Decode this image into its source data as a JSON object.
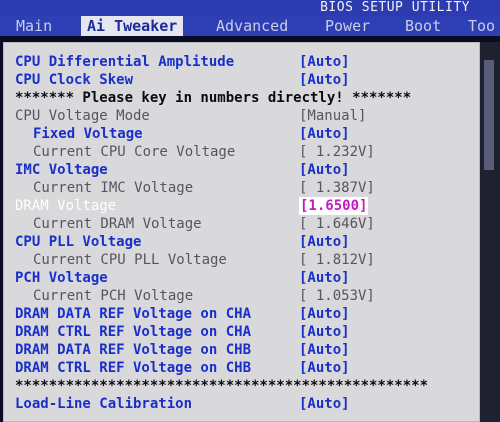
{
  "window": {
    "title": "BIOS SETUP UTILITY"
  },
  "tabs": [
    {
      "label": "Main"
    },
    {
      "label": "Ai Tweaker"
    },
    {
      "label": "Advanced"
    },
    {
      "label": "Power"
    },
    {
      "label": "Boot"
    },
    {
      "label": "Too"
    }
  ],
  "active_tab": "Ai Tweaker",
  "settings": {
    "cpu_diff_amp": {
      "label": "CPU Differential Amplitude",
      "value": "[Auto]"
    },
    "cpu_clock_skew": {
      "label": "CPU Clock Skew",
      "value": "[Auto]"
    },
    "notice": "******* Please key in numbers directly! *******",
    "cpu_voltage_mode": {
      "label": "CPU Voltage Mode",
      "value": "[Manual]"
    },
    "fixed_voltage": {
      "label": "Fixed Voltage",
      "value": "[Auto]"
    },
    "current_cpu_core_voltage": {
      "label": "Current CPU Core Voltage",
      "value": "[ 1.232V]"
    },
    "imc_voltage": {
      "label": "IMC Voltage",
      "value": "[Auto]"
    },
    "current_imc_voltage": {
      "label": "Current IMC Voltage",
      "value": "[ 1.387V]"
    },
    "dram_voltage": {
      "label": "DRAM Voltage",
      "value": "[1.6500]"
    },
    "current_dram_voltage": {
      "label": "Current DRAM Voltage",
      "value": "[ 1.646V]"
    },
    "cpu_pll_voltage": {
      "label": "CPU PLL Voltage",
      "value": "[Auto]"
    },
    "current_cpu_pll_voltage": {
      "label": "Current CPU PLL Voltage",
      "value": "[ 1.812V]"
    },
    "pch_voltage": {
      "label": "PCH Voltage",
      "value": "[Auto]"
    },
    "current_pch_voltage": {
      "label": "Current PCH Voltage",
      "value": "[ 1.053V]"
    },
    "dram_data_ref_cha": {
      "label": "DRAM DATA REF Voltage on CHA",
      "value": "[Auto]"
    },
    "dram_ctrl_ref_cha": {
      "label": "DRAM CTRL REF Voltage on CHA",
      "value": "[Auto]"
    },
    "dram_data_ref_chb": {
      "label": "DRAM DATA REF Voltage on CHB",
      "value": "[Auto]"
    },
    "dram_ctrl_ref_chb": {
      "label": "DRAM CTRL REF Voltage on CHB",
      "value": "[Auto]"
    },
    "separator": "*************************************************",
    "load_line": {
      "label": "Load-Line Calibration",
      "value": "[Auto]"
    }
  },
  "colors": {
    "setting_blue": "#1a2fc9",
    "info_gray": "#55555c",
    "selected_value": "#c21bc2",
    "panel_bg": "#d9d9dc",
    "header_blue": "#2e3fb6"
  }
}
